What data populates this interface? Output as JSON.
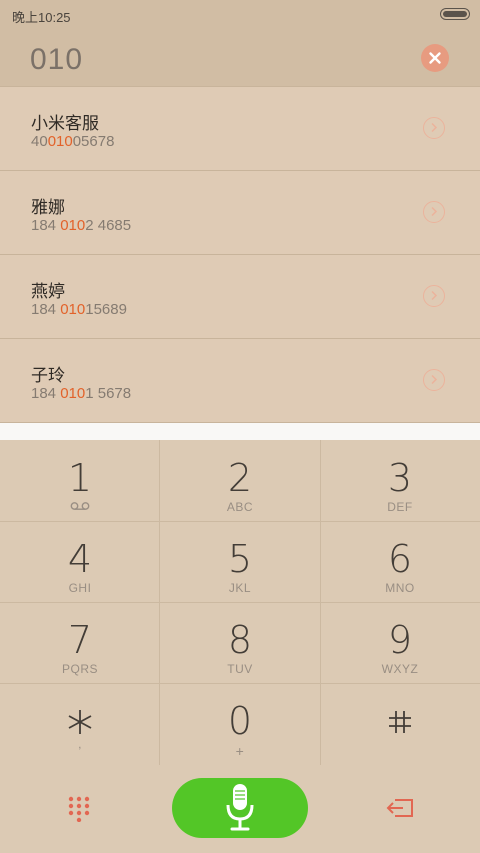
{
  "status_bar": {
    "time": "晚上10:25"
  },
  "search": {
    "typed_number": "010"
  },
  "results": [
    {
      "name": "小米客服",
      "pre": "40",
      "match": "010",
      "post": "05678"
    },
    {
      "name": "雅娜",
      "pre": "184 ",
      "match": "010",
      "post": "2 4685"
    },
    {
      "name": "燕婷",
      "pre": "184 ",
      "match": "010",
      "post": "15689"
    },
    {
      "name": "子玲",
      "pre": "184 ",
      "match": "010",
      "post": "1 5678"
    }
  ],
  "keypad": {
    "k1": {
      "digit": "1",
      "letters": ""
    },
    "k2": {
      "digit": "2",
      "letters": "ABC"
    },
    "k3": {
      "digit": "3",
      "letters": "DEF"
    },
    "k4": {
      "digit": "4",
      "letters": "GHI"
    },
    "k5": {
      "digit": "5",
      "letters": "JKL"
    },
    "k6": {
      "digit": "6",
      "letters": "MNO"
    },
    "k7": {
      "digit": "7",
      "letters": "PQRS"
    },
    "k8": {
      "digit": "8",
      "letters": "TUV"
    },
    "k9": {
      "digit": "9",
      "letters": "WXYZ"
    },
    "star": {
      "digit": "*",
      "letters": ","
    },
    "k0": {
      "digit": "0",
      "letters": "+"
    },
    "hash": {
      "digit": "#",
      "letters": ""
    }
  },
  "icons": {
    "voicemail": "voicemail-icon",
    "clear": "clear-icon",
    "chevron": "chevron-right-icon",
    "dialpad": "dialpad-icon",
    "mic": "microphone-icon",
    "backspace": "backspace-icon"
  },
  "colors": {
    "highlight": "#e2622a",
    "call_button": "#53c627",
    "clear_button": "#e79b80",
    "accent_icon": "#e26752"
  }
}
